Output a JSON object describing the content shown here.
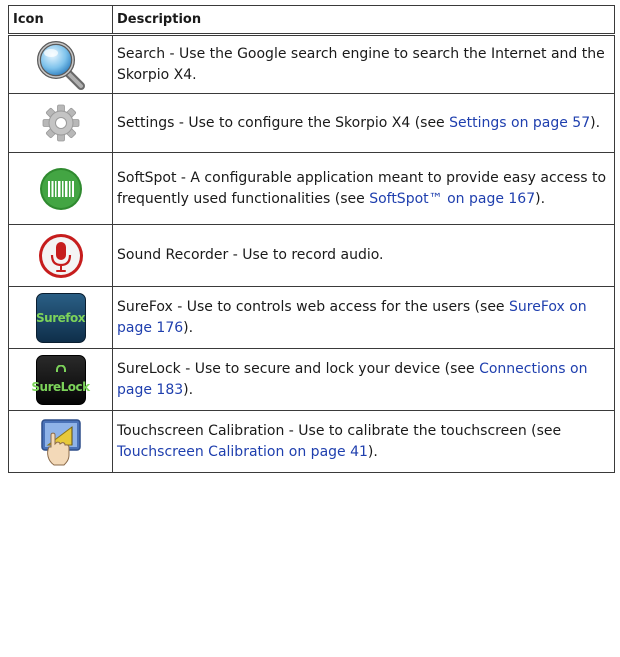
{
  "header": {
    "icon": "Icon",
    "description": "Description"
  },
  "rows": [
    {
      "icon": "search-icon",
      "parts": [
        {
          "text": "Search - Use the Google search engine to search the Internet and the Skorpio X4."
        }
      ]
    },
    {
      "icon": "gear-icon",
      "parts": [
        {
          "text": "Settings - Use to configure the Skorpio X4 (see "
        },
        {
          "text": "Settings on page 57",
          "link": true
        },
        {
          "text": ")."
        }
      ]
    },
    {
      "icon": "barcode-icon",
      "parts": [
        {
          "text": "SoftSpot - A configurable application meant to provide easy access to frequently used functionalities (see "
        },
        {
          "text": "SoftSpot™ on page 167",
          "link": true
        },
        {
          "text": ")."
        }
      ]
    },
    {
      "icon": "microphone-icon",
      "parts": [
        {
          "text": "Sound Recorder - Use to record audio."
        }
      ]
    },
    {
      "icon": "surefox-icon",
      "icon_label": "Surefox",
      "parts": [
        {
          "text": "SureFox - Use to controls web access for the users (see "
        },
        {
          "text": "SureFox on page 176",
          "link": true
        },
        {
          "text": ")."
        }
      ]
    },
    {
      "icon": "surelock-icon",
      "icon_label": "SureLock",
      "parts": [
        {
          "text": "SureLock - Use to secure and lock your device (see "
        },
        {
          "text": "Connections on page 183",
          "link": true
        },
        {
          "text": ")."
        }
      ]
    },
    {
      "icon": "touchscreen-calibration-icon",
      "parts": [
        {
          "text": "Touchscreen Calibration - Use to calibrate the touchscreen (see "
        },
        {
          "text": "Touchscreen Calibration on page 41",
          "link": true
        },
        {
          "text": ")."
        }
      ]
    }
  ],
  "colors": {
    "link": "#1f3fae",
    "border": "#3a3a3a"
  }
}
